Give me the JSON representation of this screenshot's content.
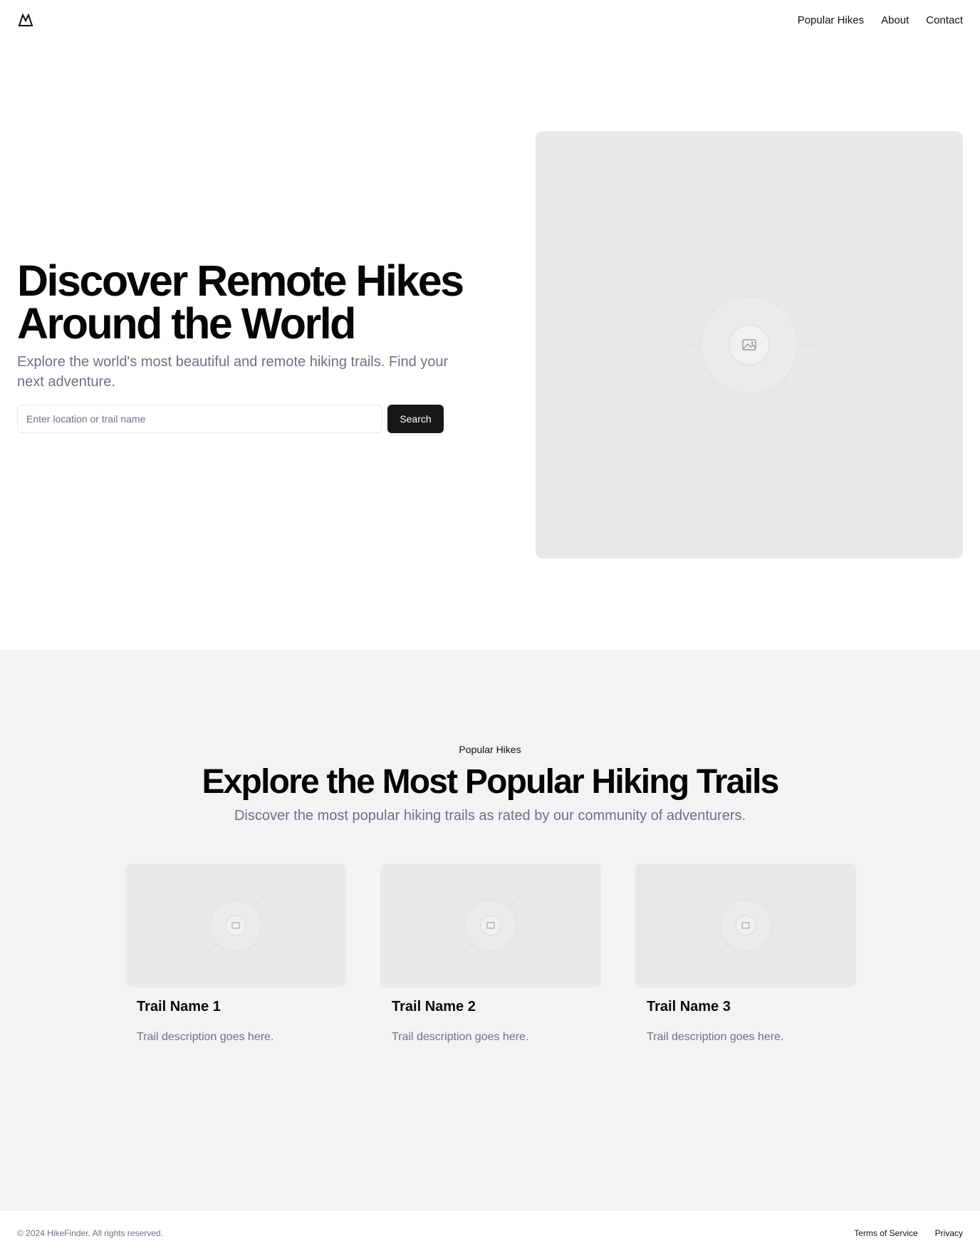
{
  "header": {
    "logo_icon": "mountain-icon",
    "nav": [
      "Popular Hikes",
      "About",
      "Contact"
    ]
  },
  "hero": {
    "title_line1": "Discover Remote Hikes",
    "title_line2": "Around the World",
    "subtitle": "Explore the world's most beautiful and remote hiking trails. Find your next adventure.",
    "search": {
      "placeholder": "Enter location or trail name",
      "value": "",
      "button_label": "Search"
    },
    "image_icon": "image-placeholder-icon"
  },
  "popular": {
    "eyebrow": "Popular Hikes",
    "title": "Explore the Most Popular Hiking Trails",
    "subtitle": "Discover the most popular hiking trails as rated by our community of adventurers.",
    "cards": [
      {
        "title": "Trail Name 1",
        "description": "Trail description goes here."
      },
      {
        "title": "Trail Name 2",
        "description": "Trail description goes here."
      },
      {
        "title": "Trail Name 3",
        "description": "Trail description goes here."
      }
    ]
  },
  "footer": {
    "copyright": "© 2024 HikeFinder. All rights reserved.",
    "links": [
      "Terms of Service",
      "Privacy"
    ]
  },
  "colors": {
    "primary_button": "#18181b",
    "placeholder_bg": "#e9e9e9",
    "section_bg": "#f2f3f5",
    "muted_text": "#6b7280"
  }
}
